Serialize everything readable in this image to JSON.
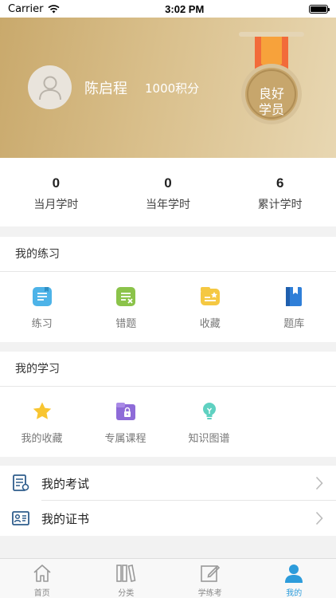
{
  "status_bar": {
    "carrier": "Carrier",
    "time": "3:02 PM"
  },
  "profile": {
    "name": "陈启程",
    "points": "1000积分",
    "badge_line1": "良好",
    "badge_line2": "学员"
  },
  "stats": [
    {
      "value": "0",
      "label": "当月学时"
    },
    {
      "value": "0",
      "label": "当年学时"
    },
    {
      "value": "6",
      "label": "累计学时"
    }
  ],
  "practice": {
    "title": "我的练习",
    "items": [
      {
        "label": "练习",
        "icon": "practice-doc-icon"
      },
      {
        "label": "错题",
        "icon": "wrong-questions-icon"
      },
      {
        "label": "收藏",
        "icon": "favorites-folder-icon"
      },
      {
        "label": "题库",
        "icon": "question-bank-book-icon"
      }
    ]
  },
  "study": {
    "title": "我的学习",
    "items": [
      {
        "label": "我的收藏",
        "icon": "star-icon"
      },
      {
        "label": "专属课程",
        "icon": "locked-folder-icon"
      },
      {
        "label": "知识图谱",
        "icon": "lightbulb-icon"
      }
    ]
  },
  "menu": [
    {
      "label": "我的考试",
      "icon": "exam-icon"
    },
    {
      "label": "我的证书",
      "icon": "certificate-icon"
    }
  ],
  "tabs": [
    {
      "label": "首页",
      "icon": "home-icon"
    },
    {
      "label": "分类",
      "icon": "category-icon"
    },
    {
      "label": "学练考",
      "icon": "edit-icon"
    },
    {
      "label": "我的",
      "icon": "profile-icon"
    }
  ],
  "colors": {
    "accent": "#2d9cdb",
    "header_gold": "#d4b680"
  }
}
